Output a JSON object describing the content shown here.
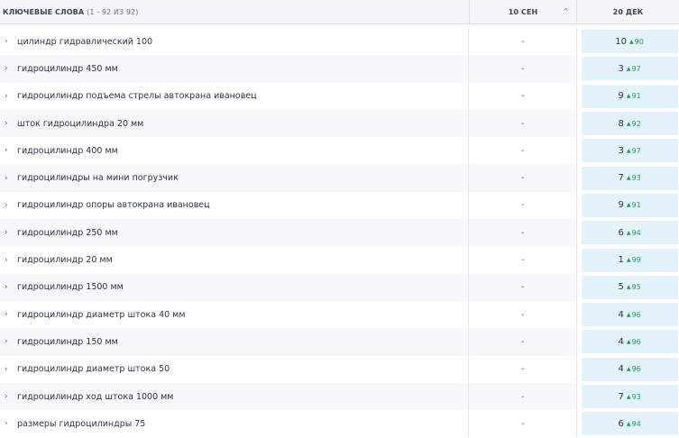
{
  "header": {
    "keywords_label": "КЛЮЧЕВЫЕ СЛОВА",
    "keywords_count": "(1 - 92 ИЗ 92)",
    "col1_label": "10 СЕН",
    "col1_sort_icon": "^",
    "col2_label": "20 ДЕК"
  },
  "rows": [
    {
      "keyword": "цилиндр гидравлический 100",
      "d1": "-",
      "pos": "10",
      "arrow": "▲",
      "delta": "90"
    },
    {
      "keyword": "гидроцилиндр 450 мм",
      "d1": "-",
      "pos": "3",
      "arrow": "▲",
      "delta": "97"
    },
    {
      "keyword": "гидроцилиндр подъема стрелы автокрана ивановец",
      "d1": "-",
      "pos": "9",
      "arrow": "▲",
      "delta": "91"
    },
    {
      "keyword": "шток гидроцилиндра 20 мм",
      "d1": "-",
      "pos": "8",
      "arrow": "▲",
      "delta": "92"
    },
    {
      "keyword": "гидроцилиндр 400 мм",
      "d1": "-",
      "pos": "3",
      "arrow": "▲",
      "delta": "97"
    },
    {
      "keyword": "гидроцилиндры на мини погрузчик",
      "d1": "-",
      "pos": "7",
      "arrow": "▲",
      "delta": "93"
    },
    {
      "keyword": "гидроцилиндр опоры автокрана ивановец",
      "d1": "-",
      "pos": "9",
      "arrow": "▲",
      "delta": "91"
    },
    {
      "keyword": "гидроцилиндр 250 мм",
      "d1": "-",
      "pos": "6",
      "arrow": "▲",
      "delta": "94"
    },
    {
      "keyword": "гидроцилиндр 20 мм",
      "d1": "-",
      "pos": "1",
      "arrow": "▲",
      "delta": "99"
    },
    {
      "keyword": "гидроцилиндр 1500 мм",
      "d1": "-",
      "pos": "5",
      "arrow": "▲",
      "delta": "95"
    },
    {
      "keyword": "гидроцилиндр диаметр штока 40 мм",
      "d1": "-",
      "pos": "4",
      "arrow": "▲",
      "delta": "96"
    },
    {
      "keyword": "гидроцилиндр 150 мм",
      "d1": "-",
      "pos": "4",
      "arrow": "▲",
      "delta": "96"
    },
    {
      "keyword": "гидроцилиндр диаметр штока 50",
      "d1": "-",
      "pos": "4",
      "arrow": "▲",
      "delta": "96"
    },
    {
      "keyword": "гидроцилиндр ход штока 1000 мм",
      "d1": "-",
      "pos": "7",
      "arrow": "▲",
      "delta": "93"
    },
    {
      "keyword": "размеры гидроцилиндры 75",
      "d1": "-",
      "pos": "6",
      "arrow": "▲",
      "delta": "94"
    }
  ],
  "icons": {
    "row_expand": "chevron-right-icon",
    "sort": "chevron-up-icon",
    "delta": "triangle-up-icon"
  },
  "colors": {
    "header_bg": "#f3f5f8",
    "alt_row_bg": "#f7f8fa",
    "badge_bg": "#e3f2fb",
    "delta_green": "#1f9d55"
  }
}
